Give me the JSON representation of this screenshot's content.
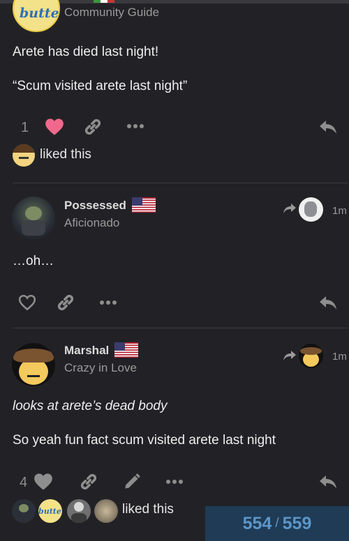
{
  "post1": {
    "user_title": "Community Guide",
    "avatar_text": "butte",
    "lines": [
      "Arete has died last night!",
      "“Scum visited arete last night”"
    ],
    "like_count": "1",
    "liked_label": "liked this"
  },
  "post2": {
    "username": "Possessed",
    "user_title": "Aficionado",
    "time": "1m",
    "lines": [
      "…oh…"
    ]
  },
  "post3": {
    "username": "Marshal",
    "user_title": "Crazy in Love",
    "time": "1m",
    "lines": [
      "looks at arete’s dead body",
      "So yeah fun fact scum visited arete last night"
    ],
    "like_count": "4",
    "liked_label": "liked this",
    "liker_avatar_text": "butte"
  },
  "progress": {
    "current": "554",
    "separator": "/",
    "total": "559"
  },
  "colors": {
    "heart_liked": "#f0698d",
    "progress_bg": "#1f3b56",
    "progress_text": "#5c96c8"
  }
}
